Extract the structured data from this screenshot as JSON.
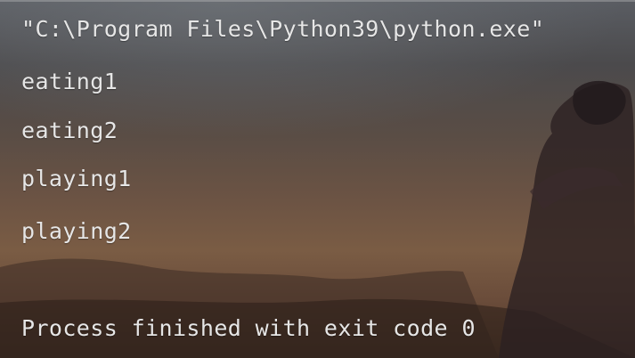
{
  "console": {
    "command_line": "\"C:\\Program Files\\Python39\\python.exe\"",
    "output_lines": [
      "eating1",
      "eating2",
      "playing1",
      "playing2"
    ],
    "exit_message": "Process finished with exit code 0"
  },
  "theme": {
    "text_color": "#e6e6e6",
    "background_image": "anime-sunset-silhouette"
  }
}
